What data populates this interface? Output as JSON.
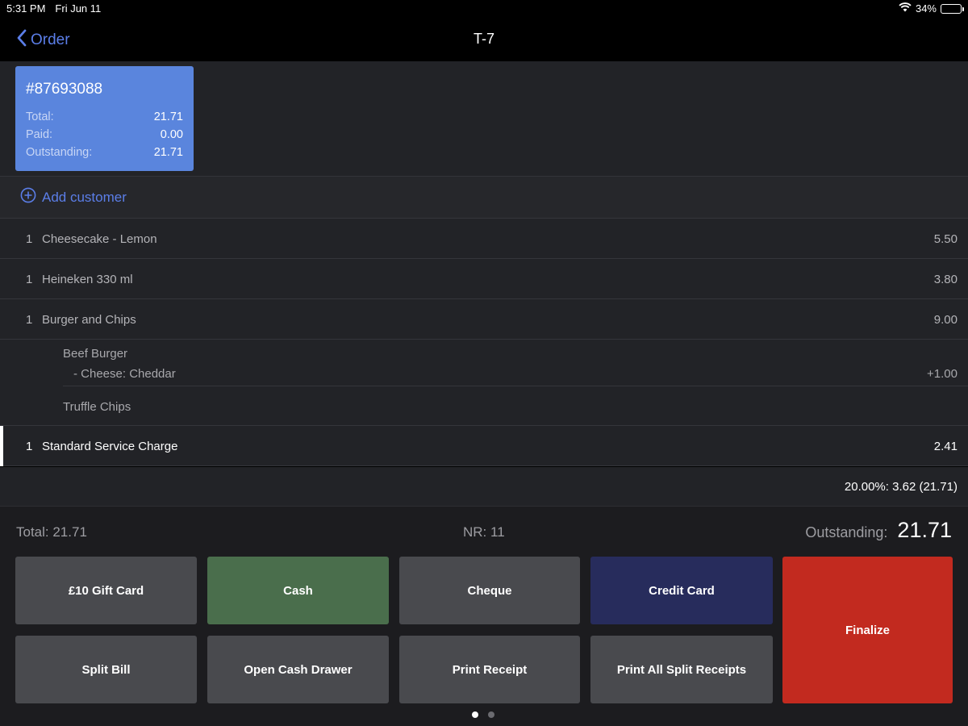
{
  "status_bar": {
    "time": "5:31 PM",
    "date": "Fri Jun 11",
    "battery": "34%",
    "battery_level": 0.34
  },
  "nav": {
    "back_label": "Order",
    "title": "T-7"
  },
  "bill": {
    "number": "#87693088",
    "total_label": "Total:",
    "total_value": "21.71",
    "paid_label": "Paid:",
    "paid_value": "0.00",
    "outstanding_label": "Outstanding:",
    "outstanding_value": "21.71"
  },
  "customer": {
    "label": "Add customer"
  },
  "items": [
    {
      "qty": "1",
      "name": "Cheesecake - Lemon",
      "price": "5.50"
    },
    {
      "qty": "1",
      "name": "Heineken 330 ml",
      "price": "3.80"
    },
    {
      "qty": "1",
      "name": "Burger and Chips",
      "price": "9.00"
    }
  ],
  "modifiers": {
    "main": "Beef Burger",
    "sub": "- Cheese:  Cheddar",
    "sub_price": "+1.00",
    "second": "Truffle Chips"
  },
  "service_charge": {
    "qty": "1",
    "name": "Standard Service Charge",
    "price": "2.41"
  },
  "tax_line": "20.00%: 3.62 (21.71)",
  "totals": {
    "total": "Total: 21.71",
    "nr": "NR: 11",
    "outstanding_label": "Outstanding:",
    "outstanding_value": "21.71"
  },
  "buttons": {
    "gift_card": "£10 Gift Card",
    "cash": "Cash",
    "cheque": "Cheque",
    "credit_card": "Credit Card",
    "finalize": "Finalize",
    "split_bill": "Split Bill",
    "open_cash_drawer": "Open Cash Drawer",
    "print_receipt": "Print Receipt",
    "print_all_split": "Print All Split Receipts"
  },
  "colors": {
    "accent": "#5b7ee8",
    "bill_card": "#5a85dd",
    "cash": "#4a6e4c",
    "credit_card": "#272c5c",
    "finalize": "#c22a1f",
    "neutral_button": "#494a4e"
  },
  "pager": {
    "pages": 2,
    "current": 1
  }
}
